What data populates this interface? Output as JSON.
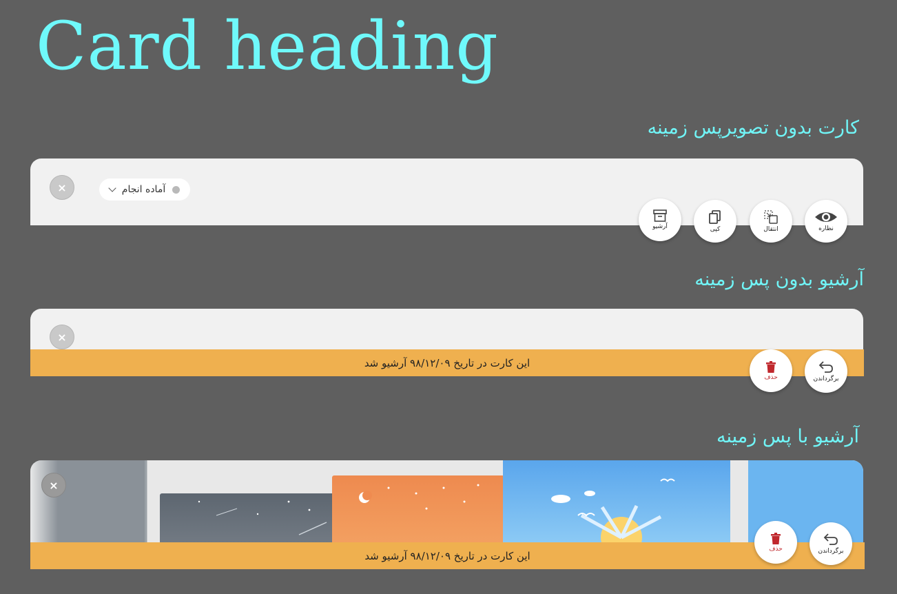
{
  "heading": "Card heading",
  "sections": [
    {
      "title": "کارت بدون تصویرپس زمینه",
      "status": "آماده انجام",
      "close_label": "×",
      "actions": [
        {
          "label": "نظاره",
          "icon": "eye-icon"
        },
        {
          "label": "انتقال",
          "icon": "move-icon"
        },
        {
          "label": "کپی",
          "icon": "copy-icon"
        },
        {
          "label": "آرشیو",
          "icon": "archive-icon"
        }
      ]
    },
    {
      "title": "آرشیو بدون پس زمینه",
      "close_label": "×",
      "banner": "این کارت در تاریخ ۹۸/۱۲/۰۹ آرشیو شد",
      "actions": [
        {
          "label": "برگرداندن",
          "icon": "restore-icon"
        },
        {
          "label": "حذف",
          "icon": "trash-icon"
        }
      ]
    },
    {
      "title": "آرشیو با پس زمینه",
      "close_label": "×",
      "banner": "این کارت در تاریخ ۹۸/۱۲/۰۹ آرشیو شد",
      "actions": [
        {
          "label": "برگرداندن",
          "icon": "restore-icon"
        },
        {
          "label": "حذف",
          "icon": "trash-icon"
        }
      ]
    }
  ],
  "colors": {
    "page_bg": "#5f5f5f",
    "heading": "#6ff9fb",
    "card_bg": "#f1f1f1",
    "banner_bg": "#efb04f",
    "delete_red": "#c0282d"
  }
}
